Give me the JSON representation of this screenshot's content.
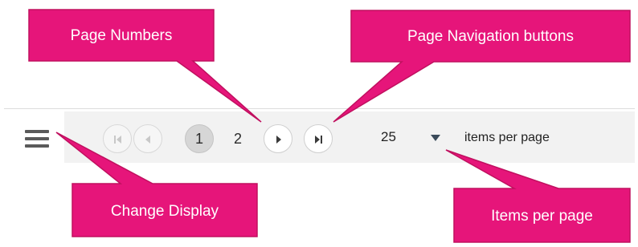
{
  "pager": {
    "pages": [
      "1",
      "2"
    ],
    "selected_page": "1",
    "page_size_value": "25",
    "items_label": "items per page"
  },
  "icons": {
    "menu": "hamburger-menu-icon",
    "first": "first-page-icon",
    "prev": "previous-page-icon",
    "next": "next-page-icon",
    "last": "last-page-icon",
    "dropdown": "dropdown-arrow-icon"
  },
  "callouts": {
    "page_numbers": "Page Numbers",
    "page_navigation": "Page Navigation buttons",
    "change_display": "Change Display",
    "items_per_page": "Items per page"
  },
  "colors": {
    "callout_fill": "#E6157A",
    "callout_stroke": "#C0105F",
    "pager_background": "#F2F2F2",
    "selected_page": "#D6D6D6",
    "icon_gray": "#5A5A5A"
  }
}
